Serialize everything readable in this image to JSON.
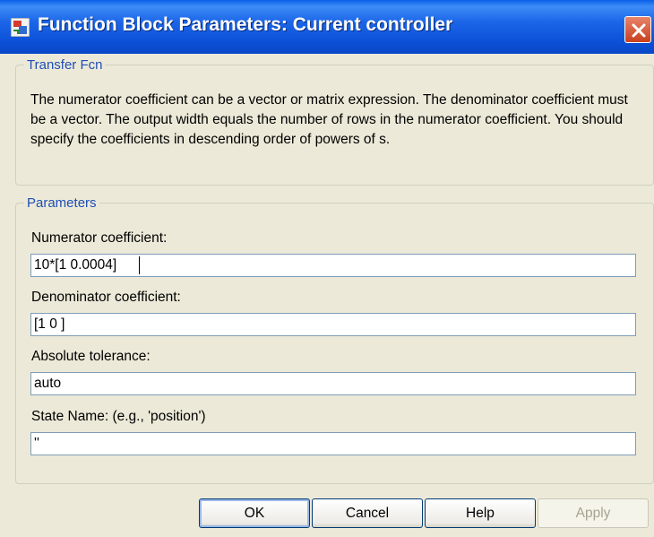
{
  "window": {
    "title": "Function Block Parameters: Current controller",
    "app_icon": "simulink-block-icon",
    "close_icon": "close-icon"
  },
  "transfer_fcn": {
    "group_label": "Transfer Fcn",
    "description": "The numerator coefficient can be a vector or matrix expression. The denominator coefficient must be a vector. The output width equals the number of rows in the numerator coefficient. You should specify the coefficients in descending order of powers of s."
  },
  "parameters": {
    "group_label": "Parameters",
    "numerator": {
      "label": "Numerator coefficient:",
      "value": "10*[1 0.0004]"
    },
    "denominator": {
      "label": "Denominator coefficient:",
      "value": "[1 0 ]"
    },
    "abs_tol": {
      "label": "Absolute tolerance:",
      "value": "auto"
    },
    "state_name": {
      "label": "State Name: (e.g., 'position')",
      "value": "''"
    }
  },
  "buttons": {
    "ok": "OK",
    "cancel": "Cancel",
    "help": "Help",
    "apply": "Apply"
  }
}
